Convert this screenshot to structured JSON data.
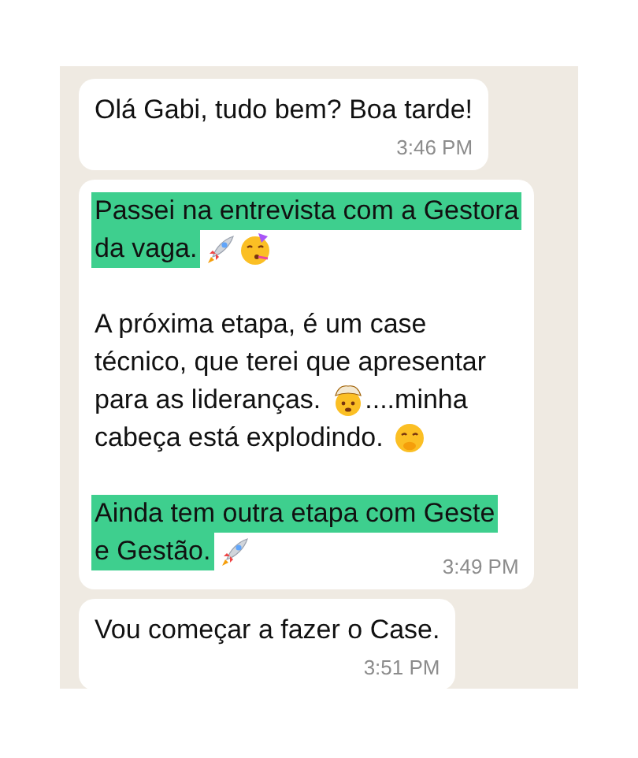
{
  "messages": [
    {
      "paragraphs": [
        [
          [
            {
              "kind": "text",
              "text": "Olá Gabi, tudo bem? Boa tarde!",
              "highlighted": false
            }
          ]
        ]
      ],
      "time": "3:46 PM"
    },
    {
      "paragraphs": [
        [
          [
            {
              "kind": "text",
              "text": "Passei na entrevista com a Gestora",
              "highlighted": true
            }
          ],
          [
            {
              "kind": "text",
              "text": "da vaga.",
              "highlighted": true
            },
            {
              "kind": "rocket"
            },
            {
              "kind": "partyface"
            }
          ]
        ],
        [
          [
            {
              "kind": "text",
              "text": "A próxima etapa, é um case",
              "highlighted": false
            }
          ],
          [
            {
              "kind": "text",
              "text": "técnico, que terei que apresentar",
              "highlighted": false
            }
          ],
          [
            {
              "kind": "text",
              "text": "para as lideranças.",
              "highlighted": false
            },
            {
              "kind": "mindblown"
            },
            {
              "kind": "text",
              "text": "....minha",
              "highlighted": false
            }
          ],
          [
            {
              "kind": "text",
              "text": "cabeça está explodindo.",
              "highlighted": false
            },
            {
              "kind": "shushface"
            }
          ]
        ],
        [
          [
            {
              "kind": "text",
              "text": "Ainda tem outra etapa com Geste",
              "highlighted": true
            }
          ],
          [
            {
              "kind": "text",
              "text": "e Gestão.",
              "highlighted": true
            },
            {
              "kind": "rocket"
            }
          ]
        ]
      ],
      "time": "3:49 PM"
    },
    {
      "paragraphs": [
        [
          [
            {
              "kind": "text",
              "text": "Vou começar a fazer o Case.",
              "highlighted": false
            }
          ]
        ]
      ],
      "time": "3:51 PM"
    }
  ]
}
